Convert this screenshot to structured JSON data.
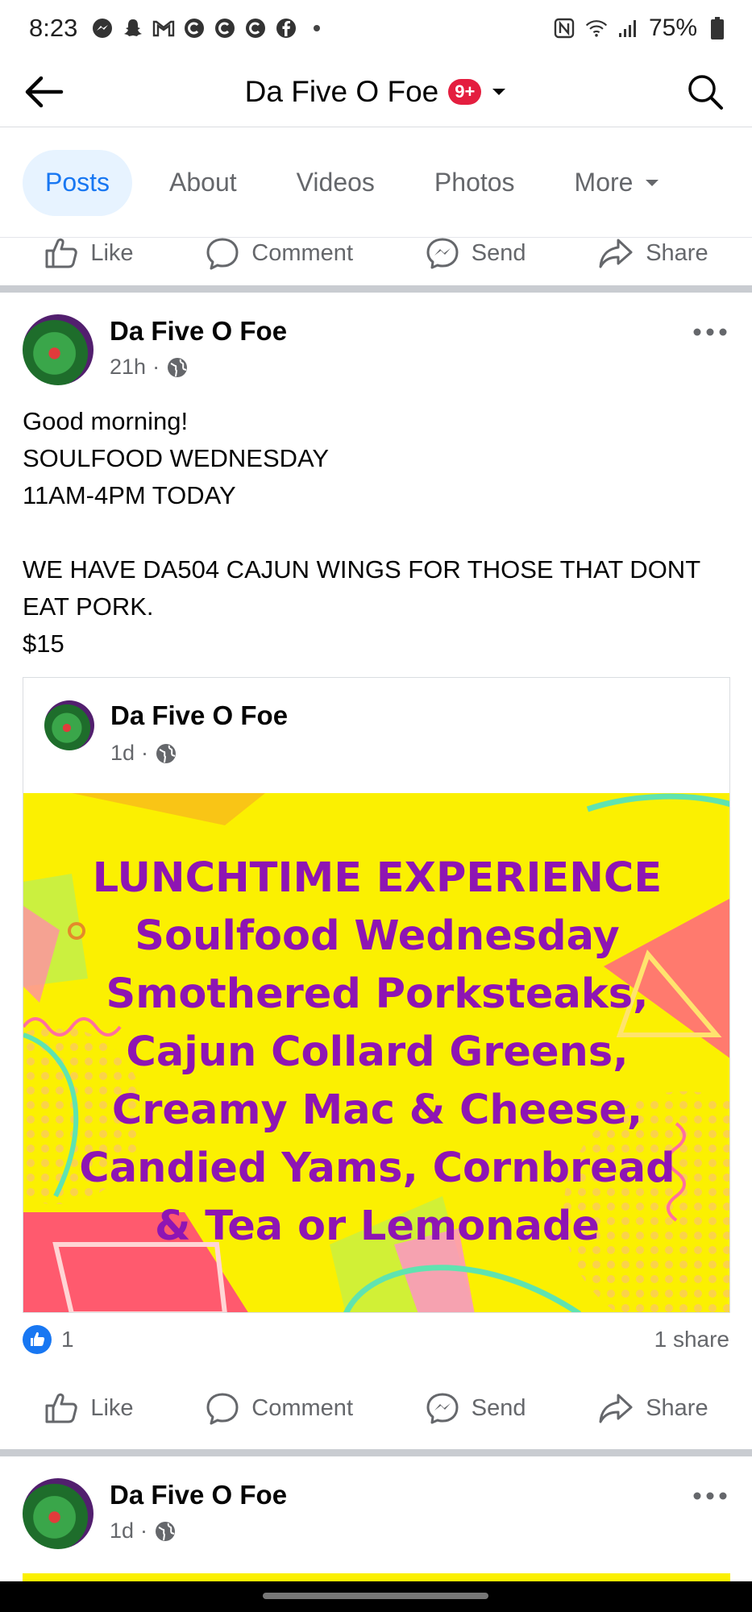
{
  "status_bar": {
    "time": "8:23",
    "battery": "75%"
  },
  "header": {
    "title": "Da Five O Foe",
    "badge": "9+"
  },
  "tabs": [
    {
      "label": "Posts",
      "active": true
    },
    {
      "label": "About",
      "active": false
    },
    {
      "label": "Videos",
      "active": false
    },
    {
      "label": "Photos",
      "active": false
    },
    {
      "label": "More",
      "active": false
    }
  ],
  "actions": {
    "like": "Like",
    "comment": "Comment",
    "send": "Send",
    "share": "Share"
  },
  "post": {
    "author": "Da Five O Foe",
    "time": "21h",
    "text": "Good morning!\nSOULFOOD WEDNESDAY\n11AM-4PM TODAY\n\nWE HAVE DA504 CAJUN WINGS FOR THOSE THAT DONT EAT PORK.\n$15",
    "shared": {
      "author": "Da Five O Foe",
      "time": "1d",
      "image_text": [
        "LUNCHTIME EXPERIENCE",
        "Soulfood Wednesday",
        "Smothered Porksteaks,",
        "Cajun Collard Greens,",
        "Creamy Mac & Cheese,",
        "Candied Yams, Cornbread",
        "& Tea or Lemonade"
      ]
    },
    "reactions_count": "1",
    "shares": "1 share"
  },
  "next_post": {
    "author": "Da Five O Foe",
    "time": "1d"
  },
  "colors": {
    "accent": "#1877f2",
    "menu_text": "#8e15b3",
    "menu_bg": "#fbf001",
    "badge": "#e41e3f"
  }
}
